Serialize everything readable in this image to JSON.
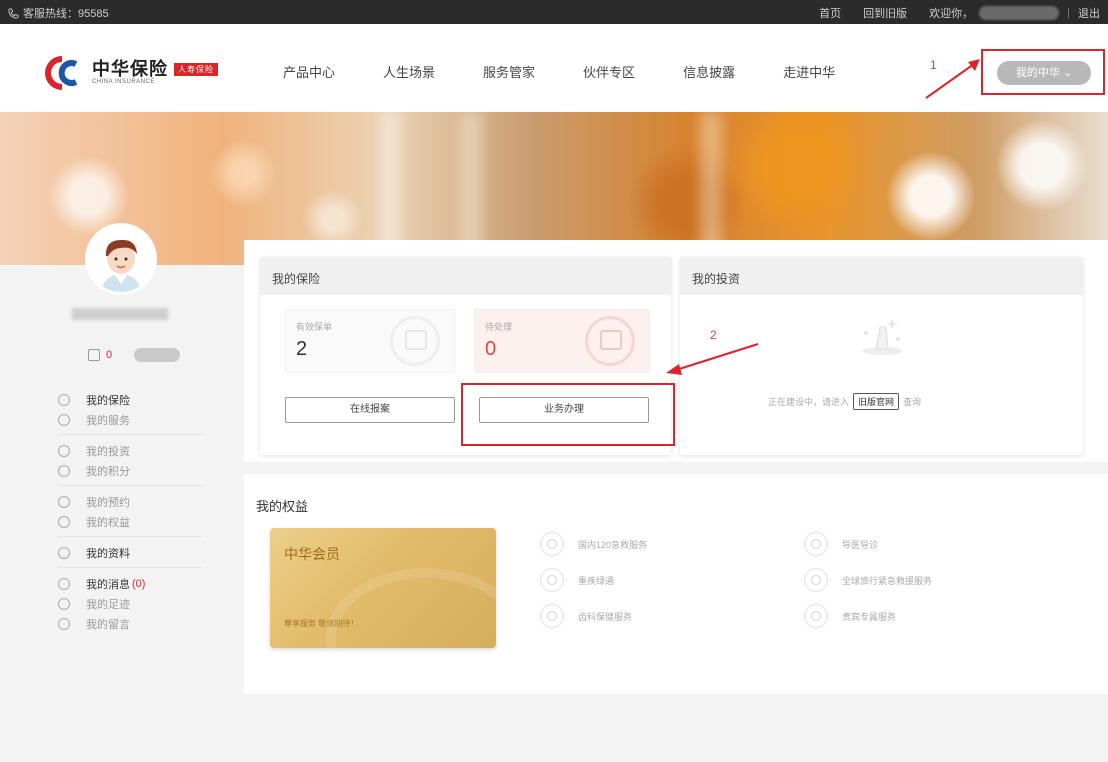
{
  "topbar": {
    "hotline": "客服热线：95585",
    "home": "首页",
    "old_version": "回到旧版",
    "welcome": "欢迎你，",
    "logout": "退出"
  },
  "logo": {
    "cn": "中华保险",
    "en": "CHINA INSURANCE",
    "tag": "人寿保险"
  },
  "nav": {
    "items": [
      "产品中心",
      "人生场景",
      "服务管家",
      "伙伴专区",
      "信息披露",
      "走进中华"
    ],
    "user_menu": "我的中华 ⌄"
  },
  "annotations": {
    "step1": "1",
    "step2": "2",
    "color": "#d9262c"
  },
  "sidebar": {
    "stat_value": "0",
    "groups": [
      [
        {
          "label": "我的保险",
          "active": true,
          "icon": "shield-icon"
        },
        {
          "label": "我的服务",
          "active": false,
          "icon": "check-circle-icon"
        }
      ],
      [
        {
          "label": "我的投资",
          "active": false,
          "icon": "money-icon"
        },
        {
          "label": "我的积分",
          "active": false,
          "icon": "coin-icon"
        }
      ],
      [
        {
          "label": "我的预约",
          "active": false,
          "icon": "clock-icon"
        },
        {
          "label": "我的权益",
          "active": false,
          "icon": "gift-icon"
        }
      ],
      [
        {
          "label": "我的资料",
          "active": true,
          "icon": "user-icon"
        }
      ],
      [
        {
          "label": "我的消息",
          "count": "(0)",
          "active": true,
          "icon": "message-icon"
        },
        {
          "label": "我的足迹",
          "active": false,
          "icon": "pin-icon"
        },
        {
          "label": "我的留言",
          "active": false,
          "icon": "note-icon"
        }
      ]
    ]
  },
  "insurance": {
    "title": "我的保险",
    "tile_valid": {
      "label": "有效保单",
      "value": "2"
    },
    "tile_pending": {
      "label": "待处理",
      "value": "0"
    },
    "btn_claim": "在线报案",
    "btn_business": "业务办理"
  },
  "investment": {
    "title": "我的投资",
    "text_prefix": "正在建设中，请进入",
    "old_site": "旧版官网",
    "text_suffix": "查询"
  },
  "benefits": {
    "title": "我的权益",
    "member_title": "中华会员",
    "member_sub": "尊享服务 敬请期待！",
    "items": [
      "国内120急救服务",
      "重疾绿通",
      "齿科保健服务",
      "导医导诊",
      "全球旅行紧急救援服务",
      "贵宾专属服务"
    ]
  }
}
